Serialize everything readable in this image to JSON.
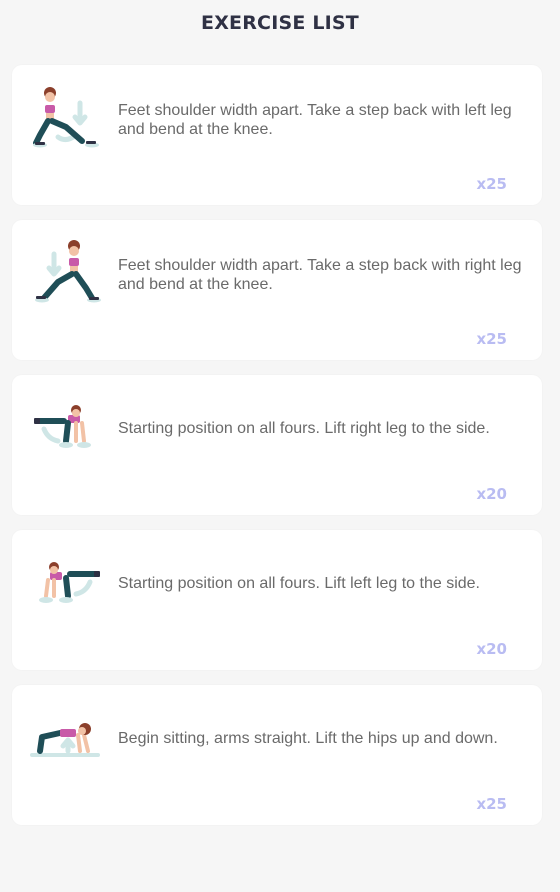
{
  "header": {
    "title": "EXERCISE LIST"
  },
  "exercises": [
    {
      "icon": "lunge-left-leg-icon",
      "description": "Feet shoulder width apart. Take a step back with left leg and bend at the knee.",
      "count": "x25"
    },
    {
      "icon": "lunge-right-leg-icon",
      "description": "Feet shoulder width apart. Take a step back with right leg and bend at the knee.",
      "count": "x25"
    },
    {
      "icon": "side-leg-lift-right-icon",
      "description": "Starting position on all fours. Lift right leg to the side.",
      "count": "x20"
    },
    {
      "icon": "side-leg-lift-left-icon",
      "description": "Starting position on all fours. Lift left leg to the side.",
      "count": "x20"
    },
    {
      "icon": "hip-raise-icon",
      "description": "Begin sitting, arms straight. Lift the hips up and down.",
      "count": "x25"
    }
  ],
  "colors": {
    "background": "#f6f6f6",
    "card": "#ffffff",
    "title": "#2f3144",
    "description": "#6a6a6a",
    "count": "#b9bcf2",
    "figure_outfit": "#1f4e57",
    "figure_top": "#c85aa8",
    "figure_skin": "#f2c2a6",
    "figure_hair": "#8b3f2b",
    "motion_hint": "#cfe6e6"
  }
}
